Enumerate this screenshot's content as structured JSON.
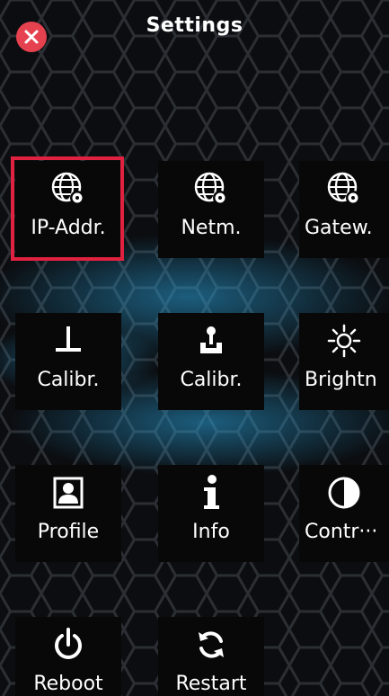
{
  "header": {
    "title": "Settings",
    "close_icon": "close-icon",
    "close_color": "#e5414f"
  },
  "tiles": [
    {
      "label": "IP-Addr.",
      "icon": "globe-gear-icon",
      "selected": true
    },
    {
      "label": "Netm.",
      "icon": "globe-gear-icon"
    },
    {
      "label": "Gatew.",
      "icon": "globe-gear-icon"
    },
    {
      "label": "Calibr.",
      "icon": "calibrate-pin-icon"
    },
    {
      "label": "Calibr.",
      "icon": "calibrate-touch-icon"
    },
    {
      "label": "Brightn",
      "icon": "sun-icon"
    },
    {
      "label": "Profile",
      "icon": "profile-icon"
    },
    {
      "label": "Info",
      "icon": "info-icon"
    },
    {
      "label": "Contr···",
      "icon": "contrast-icon"
    },
    {
      "label": "Reboot",
      "icon": "power-icon"
    },
    {
      "label": "Restart",
      "icon": "refresh-icon"
    }
  ],
  "colors": {
    "background": "#0b0d10",
    "hex_glow": "#2a9fd6",
    "tile": "#080808",
    "selection": "#e0213f"
  }
}
